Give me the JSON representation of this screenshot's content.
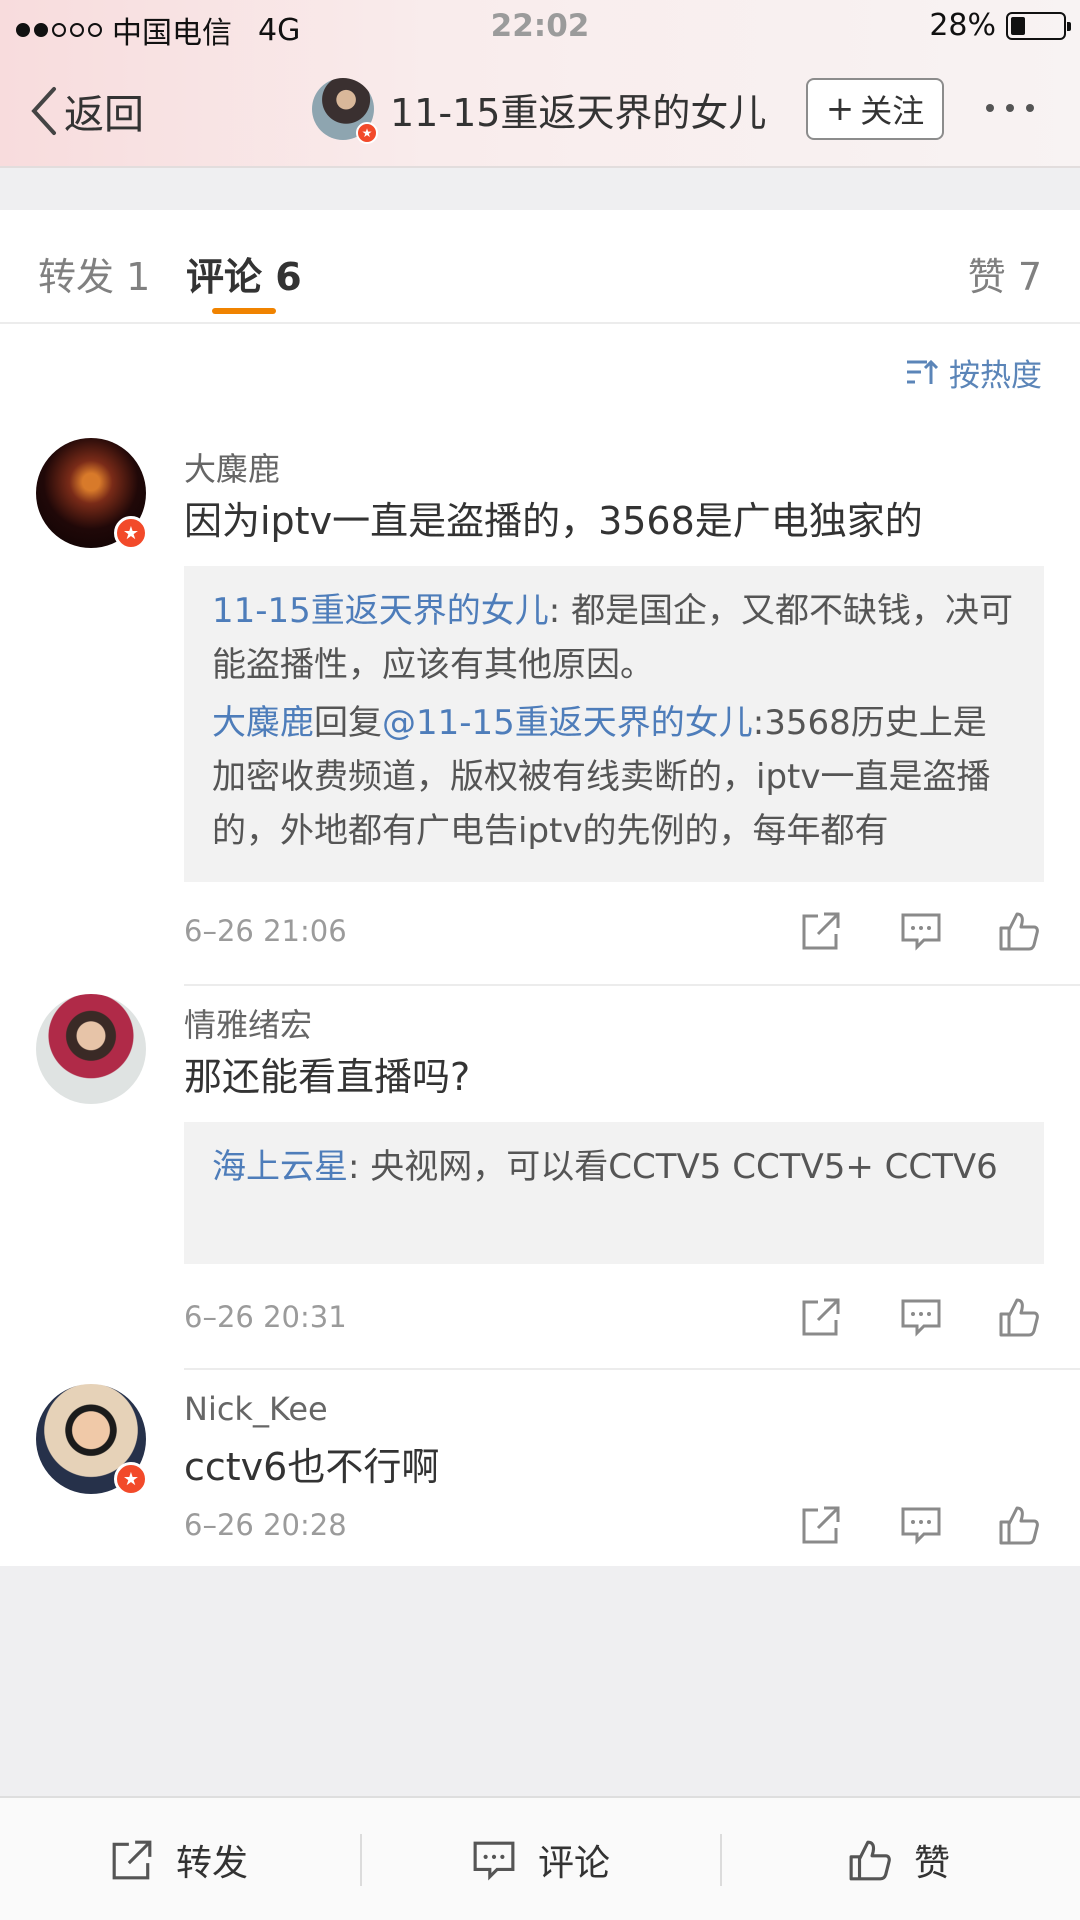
{
  "status_bar": {
    "carrier": "中国电信",
    "network": "4G",
    "time": "22:02",
    "battery": "28%",
    "battery_level": 0.28,
    "signal_bars_filled": 2,
    "signal_bars_total": 5
  },
  "nav": {
    "back_label": "返回",
    "title": "11-15重返天界的女儿",
    "follow_label": "关注"
  },
  "tabs": {
    "repost": "转发 1",
    "comments": "评论 6",
    "likes": "赞 7"
  },
  "sort_label": "按热度",
  "comments": [
    {
      "name": "大麋鹿",
      "text": "因为iptv一直是盗播的，3568是广电独家的",
      "time": "6–26 21:06",
      "verified": true,
      "replies": [
        {
          "author": "11-15重返天界的女儿",
          "sep": ": ",
          "text": "都是国企，又都不缺钱，决可能盗播性，应该有其他原因。"
        },
        {
          "author": "大麋鹿",
          "verb": "回复",
          "mention": "@11-15重返天界的女儿",
          "sep": ":",
          "text": "3568历史上是加密收费频道，版权被有线卖断的，iptv一直是盗播的，外地都有广电告iptv的先例的，每年都有"
        }
      ]
    },
    {
      "name": "情雅绪宏",
      "text": "那还能看直播吗?",
      "time": "6–26 20:31",
      "verified": false,
      "replies": [
        {
          "author": "海上云星",
          "sep": ": ",
          "text": "央视网，可以看CCTV5 CCTV5+ CCTV6"
        }
      ]
    },
    {
      "name": "Nick_Kee",
      "text": "cctv6也不行啊",
      "time": "6–26 20:28",
      "verified": true,
      "replies": []
    }
  ],
  "bottom_bar": {
    "repost": "转发",
    "comment": "评论",
    "like": "赞"
  },
  "colors": {
    "accent": "#f08300",
    "link": "#4e7dba",
    "verified_badge": "#f24a2a"
  },
  "icons": [
    "back-chevron-icon",
    "verified-icon",
    "sort-icon",
    "share-icon",
    "comment-icon",
    "like-icon",
    "more-icon"
  ]
}
